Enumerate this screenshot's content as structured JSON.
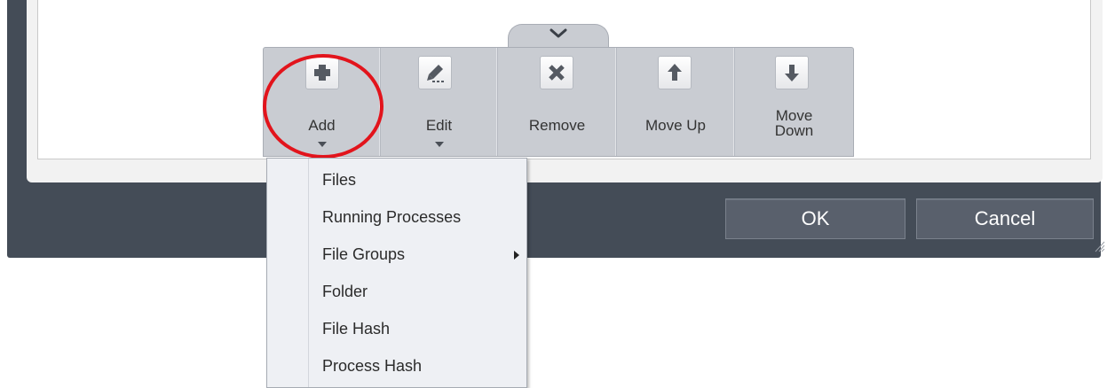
{
  "toolbar": {
    "buttons": [
      {
        "label": "Add",
        "icon": "plus-icon",
        "has_dropdown": true
      },
      {
        "label": "Edit",
        "icon": "pencil-icon",
        "has_dropdown": true
      },
      {
        "label": "Remove",
        "icon": "x-icon",
        "has_dropdown": false
      },
      {
        "label": "Move Up",
        "icon": "arrow-up-icon",
        "has_dropdown": false
      },
      {
        "label_line1": "Move",
        "label_line2": "Down",
        "icon": "arrow-down-icon",
        "has_dropdown": false
      }
    ],
    "collapse_icon": "chevron-down-icon"
  },
  "dialog": {
    "ok_label": "OK",
    "cancel_label": "Cancel"
  },
  "add_menu": {
    "items": [
      {
        "label": "Files"
      },
      {
        "label": "Running Processes"
      },
      {
        "label": "File Groups",
        "has_submenu": true
      },
      {
        "label": "Folder"
      },
      {
        "label": "File Hash"
      },
      {
        "label": "Process Hash"
      }
    ]
  },
  "colors": {
    "dialog_background": "#444c57",
    "toolbar_background": "#c9ccd2",
    "highlight_circle": "#e2141c",
    "menu_background": "#eef0f4"
  }
}
